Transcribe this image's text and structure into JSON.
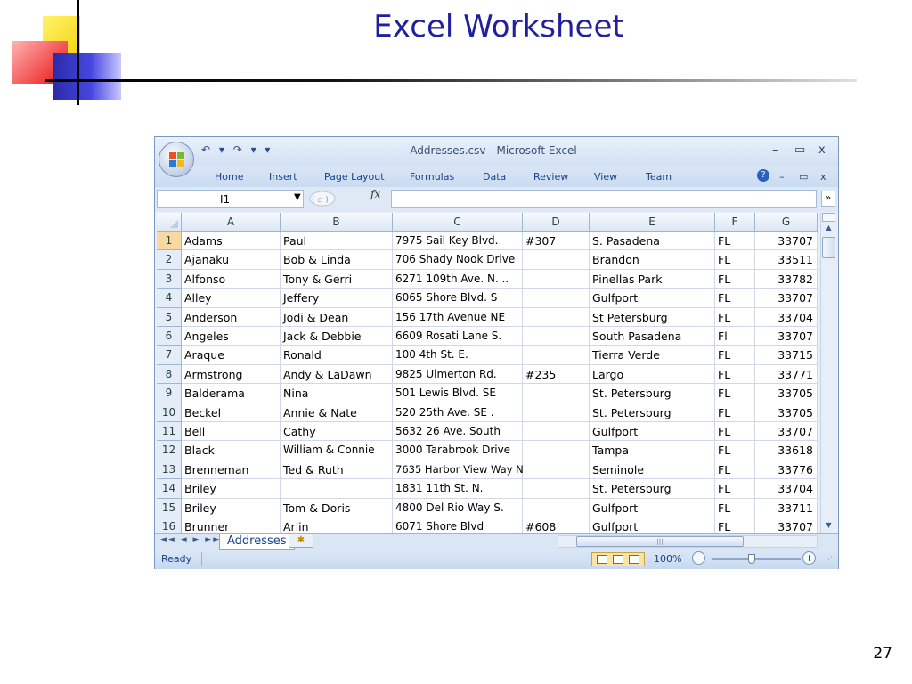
{
  "slide": {
    "title": "Excel Worksheet",
    "page_number": "27"
  },
  "window": {
    "title": "Addresses.csv - Microsoft Excel",
    "quick_access": "↶ ▾ ↷ ▾ ▾",
    "minimize": "–",
    "restore": "▭",
    "close": "x"
  },
  "ribbon": {
    "tabs": [
      "Home",
      "Insert",
      "Page Layout",
      "Formulas",
      "Data",
      "Review",
      "View",
      "Team"
    ],
    "help": "?",
    "minimize": "–",
    "restore": "▭",
    "close": "x"
  },
  "formula_bar": {
    "name_box": "I1",
    "fx": "fx",
    "formula": "",
    "expand": "»"
  },
  "sheet": {
    "columns": [
      "A",
      "B",
      "C",
      "D",
      "E",
      "F",
      "G"
    ],
    "rows": [
      [
        "1",
        "Adams",
        "Paul",
        "7975 Sail Key Blvd.",
        "#307",
        "S. Pasadena",
        "FL",
        "33707"
      ],
      [
        "2",
        "Ajanaku",
        "Bob & Linda",
        "706 Shady Nook Drive",
        "",
        "Brandon",
        "FL",
        "33511"
      ],
      [
        "3",
        "Alfonso",
        "Tony & Gerri",
        "6271 109th Ave. N. ..",
        "",
        "Pinellas Park",
        "FL",
        "33782"
      ],
      [
        "4",
        "Alley",
        "Jeffery",
        "6065 Shore Blvd. S",
        "",
        "Gulfport",
        "FL",
        "33707"
      ],
      [
        "5",
        "Anderson",
        "Jodi & Dean",
        "156 17th Avenue NE",
        "",
        "St Petersburg",
        "FL",
        "33704"
      ],
      [
        "6",
        "Angeles",
        "Jack & Debbie",
        "6609 Rosati Lane S.",
        "",
        "South Pasadena",
        "Fl",
        "33707"
      ],
      [
        "7",
        "Araque",
        "Ronald",
        "100 4th St. E.",
        "",
        "Tierra Verde",
        "FL",
        "33715"
      ],
      [
        "8",
        "Armstrong",
        "Andy & LaDawn",
        "9825 Ulmerton Rd.",
        "#235",
        "Largo",
        "FL",
        "33771"
      ],
      [
        "9",
        "Balderama",
        "Nina",
        "501 Lewis Blvd. SE",
        "",
        "St. Petersburg",
        "FL",
        "33705"
      ],
      [
        "10",
        "Beckel",
        "Annie & Nate",
        "520 25th Ave. SE .",
        "",
        "St. Petersburg",
        "FL",
        "33705"
      ],
      [
        "11",
        "Bell",
        "Cathy",
        "5632 26 Ave. South",
        "",
        "Gulfport",
        "FL",
        "33707"
      ],
      [
        "12",
        "Black",
        "William & Connie",
        "3000 Tarabrook Drive",
        "",
        "Tampa",
        "FL",
        "33618"
      ],
      [
        "13",
        "Brenneman",
        "Ted & Ruth",
        "7635 Harbor View Way N",
        "",
        "Seminole",
        "FL",
        "33776"
      ],
      [
        "14",
        "Briley",
        "",
        "1831 11th St. N.",
        "",
        "St. Petersburg",
        "FL",
        "33704"
      ],
      [
        "15",
        "Briley",
        "Tom & Doris",
        "4800 Del Rio Way S.",
        "",
        "Gulfport",
        "FL",
        "33711"
      ],
      [
        "16",
        "Brunner",
        "Arlin",
        "6071 Shore Blvd",
        "#608",
        "Gulfport",
        "FL",
        "33707"
      ]
    ]
  },
  "tabs_bar": {
    "nav": "◄◄ ◄ ► ►►",
    "sheet_tab": "Addresses",
    "new_sheet": "✱",
    "hscroll_grip": "|||"
  },
  "status_bar": {
    "status": "Ready",
    "zoom": "100%",
    "zoom_minus": "−",
    "zoom_plus": "+",
    "grip": "⋰"
  }
}
